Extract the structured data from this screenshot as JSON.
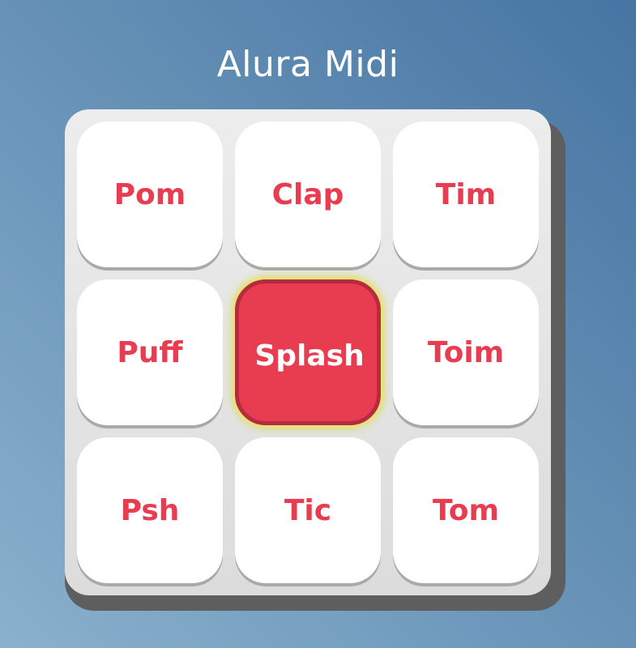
{
  "app": {
    "title": "Alura Midi"
  },
  "colors": {
    "pad_text": "#e83c51",
    "pad_active_bg": "#e83c51",
    "pad_bg": "#ffffff",
    "board_shadow": "#5e5e5e"
  },
  "pads": [
    {
      "label": "Pom",
      "active": false
    },
    {
      "label": "Clap",
      "active": false
    },
    {
      "label": "Tim",
      "active": false
    },
    {
      "label": "Puff",
      "active": false
    },
    {
      "label": "Splash",
      "active": true
    },
    {
      "label": "Toim",
      "active": false
    },
    {
      "label": "Psh",
      "active": false
    },
    {
      "label": "Tic",
      "active": false
    },
    {
      "label": "Tom",
      "active": false
    }
  ]
}
